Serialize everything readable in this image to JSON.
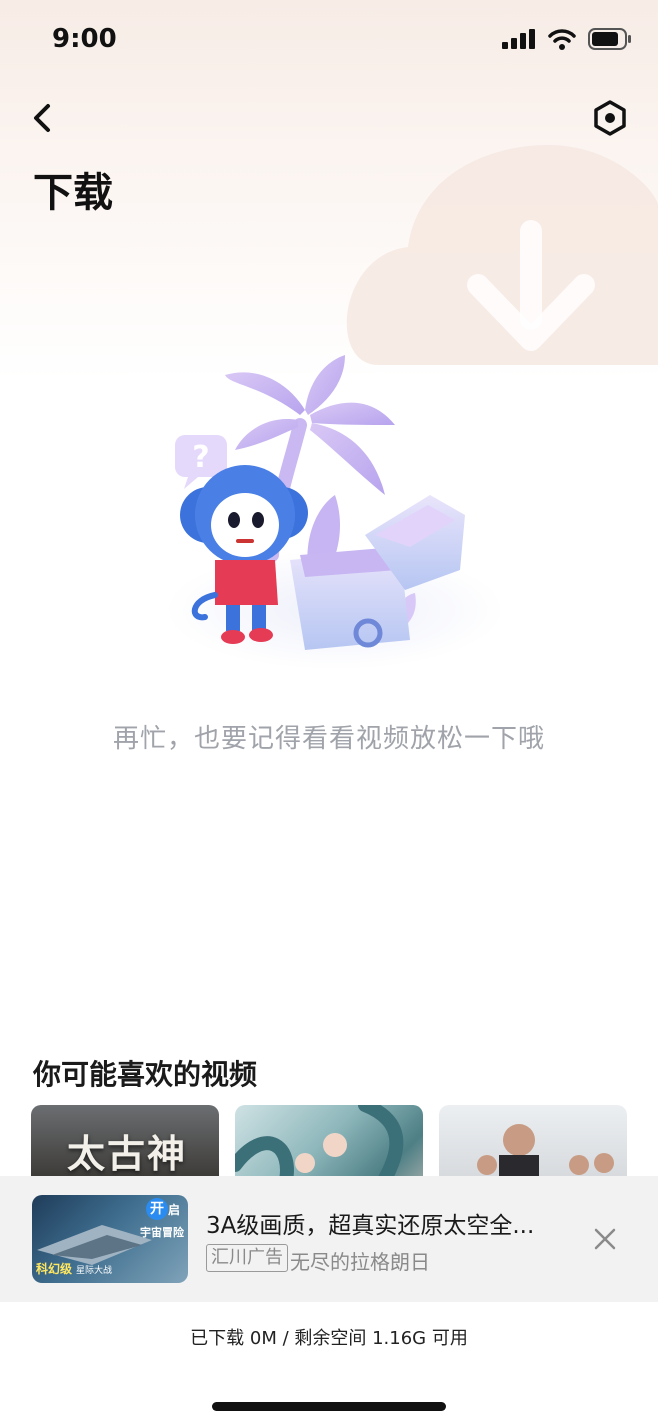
{
  "status_bar": {
    "time": "9:00",
    "icons": [
      "signal-icon",
      "wifi-icon",
      "battery-icon"
    ]
  },
  "nav": {
    "back_icon": "chevron-left-icon",
    "settings_icon": "settings-hexagon-icon"
  },
  "page": {
    "title": "下载",
    "empty_message": "再忙，也要记得看看视频放松一下哦"
  },
  "recommendations": {
    "title": "你可能喜欢的视频",
    "items": [
      {
        "thumb_text": "太古神王"
      },
      {
        "thumb_text": ""
      },
      {
        "thumb_text": ""
      }
    ]
  },
  "ad": {
    "title": "3A级画质，超真实还原太空全...",
    "tag": "汇川广告",
    "subtitle": "无尽的拉格朗日",
    "thumb_badge_1": "开",
    "thumb_badge_2": "启",
    "thumb_sub": "宇宙冒险",
    "thumb_foot": "科幻级",
    "thumb_foot_2": "星际大战",
    "close_icon": "close-icon"
  },
  "storage": {
    "text": "已下载 0M / 剩余空间 1.16G 可用"
  },
  "colors": {
    "accent_gradient_top": "#f7ece6",
    "empty_text": "#a0a3aa",
    "ad_background": "#f2f2f3"
  }
}
